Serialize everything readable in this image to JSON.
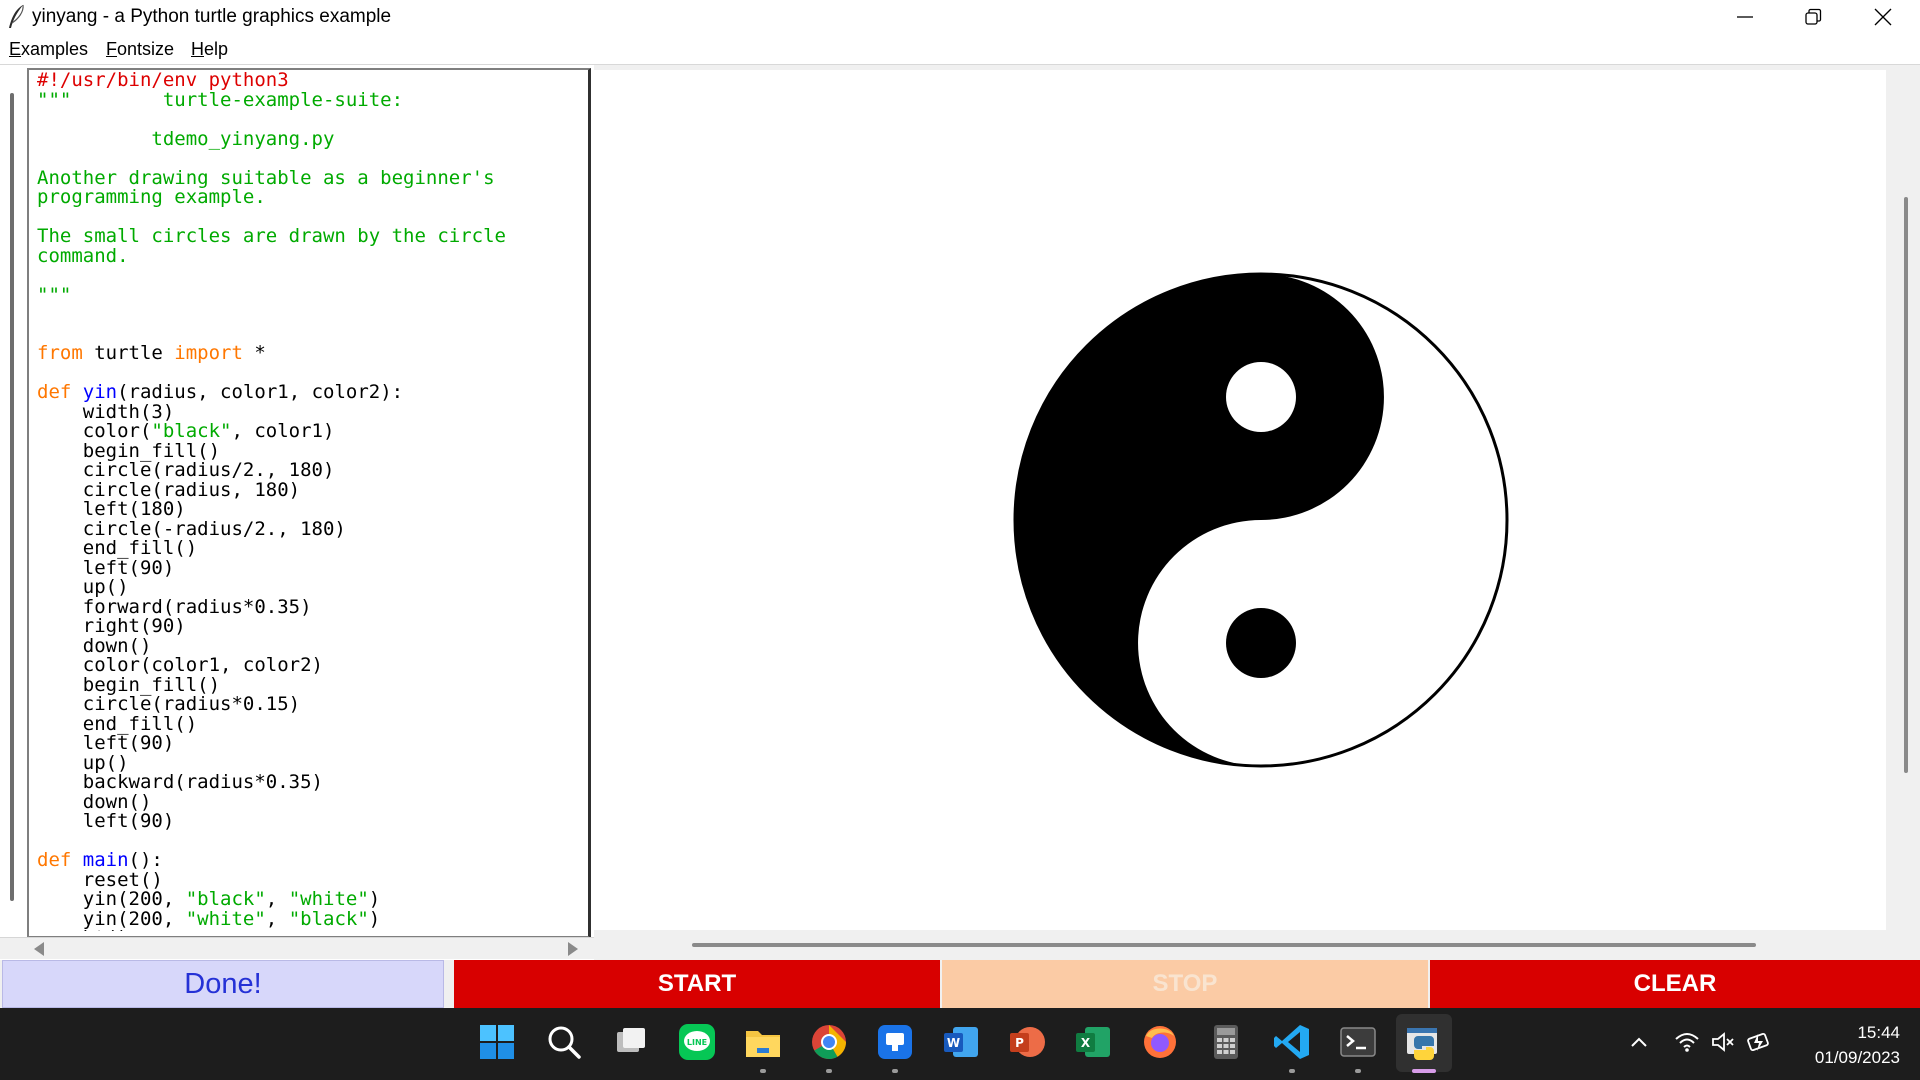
{
  "window": {
    "title": "yinyang - a Python turtle graphics example",
    "controls": [
      "minimize",
      "restore",
      "close"
    ]
  },
  "menu": {
    "items": [
      {
        "label": "Examples",
        "accel": "E",
        "rest": "xamples"
      },
      {
        "label": "Fontsize",
        "accel": "F",
        "rest": "ontsize"
      },
      {
        "label": "Help",
        "accel": "H",
        "rest": "elp"
      }
    ]
  },
  "colors": {
    "code_default": "#000000",
    "code_keyword": "#ff7700",
    "code_string": "#00aa00",
    "code_definition": "#0000ff",
    "code_comment": "#dd0000",
    "button_start": "#d80000",
    "button_stop": "#fbcba5",
    "button_clear": "#d80000",
    "button_done_bg": "#d7d7fa",
    "button_done_text": "#2531d6"
  },
  "code": {
    "lines": [
      [
        {
          "t": "#!/usr/bin/env python3",
          "c": "comment"
        }
      ],
      [
        {
          "t": "\"\"\"        turtle-example-suite:",
          "c": "string"
        }
      ],
      [
        {
          "t": "",
          "c": "string"
        }
      ],
      [
        {
          "t": "          tdemo_yinyang.py",
          "c": "string"
        }
      ],
      [
        {
          "t": "",
          "c": "string"
        }
      ],
      [
        {
          "t": "Another drawing suitable as a beginner's",
          "c": "string"
        }
      ],
      [
        {
          "t": "programming example.",
          "c": "string"
        }
      ],
      [
        {
          "t": "",
          "c": "string"
        }
      ],
      [
        {
          "t": "The small circles are drawn by the circle",
          "c": "string"
        }
      ],
      [
        {
          "t": "command.",
          "c": "string"
        }
      ],
      [
        {
          "t": "",
          "c": "string"
        }
      ],
      [
        {
          "t": "\"\"\"",
          "c": "string"
        }
      ],
      [
        {
          "t": "",
          "c": "default"
        }
      ],
      [
        {
          "t": "",
          "c": "default"
        }
      ],
      [
        {
          "t": "from",
          "c": "keyword"
        },
        {
          "t": " turtle ",
          "c": "default"
        },
        {
          "t": "import",
          "c": "keyword"
        },
        {
          "t": " *",
          "c": "default"
        }
      ],
      [
        {
          "t": "",
          "c": "default"
        }
      ],
      [
        {
          "t": "def",
          "c": "keyword"
        },
        {
          "t": " ",
          "c": "default"
        },
        {
          "t": "yin",
          "c": "definition"
        },
        {
          "t": "(radius, color1, color2):",
          "c": "default"
        }
      ],
      [
        {
          "t": "    width(3)",
          "c": "default"
        }
      ],
      [
        {
          "t": "    color(",
          "c": "default"
        },
        {
          "t": "\"black\"",
          "c": "string"
        },
        {
          "t": ", color1)",
          "c": "default"
        }
      ],
      [
        {
          "t": "    begin_fill()",
          "c": "default"
        }
      ],
      [
        {
          "t": "    circle(radius/2., 180)",
          "c": "default"
        }
      ],
      [
        {
          "t": "    circle(radius, 180)",
          "c": "default"
        }
      ],
      [
        {
          "t": "    left(180)",
          "c": "default"
        }
      ],
      [
        {
          "t": "    circle(-radius/2., 180)",
          "c": "default"
        }
      ],
      [
        {
          "t": "    end_fill()",
          "c": "default"
        }
      ],
      [
        {
          "t": "    left(90)",
          "c": "default"
        }
      ],
      [
        {
          "t": "    up()",
          "c": "default"
        }
      ],
      [
        {
          "t": "    forward(radius*0.35)",
          "c": "default"
        }
      ],
      [
        {
          "t": "    right(90)",
          "c": "default"
        }
      ],
      [
        {
          "t": "    down()",
          "c": "default"
        }
      ],
      [
        {
          "t": "    color(color1, color2)",
          "c": "default"
        }
      ],
      [
        {
          "t": "    begin_fill()",
          "c": "default"
        }
      ],
      [
        {
          "t": "    circle(radius*0.15)",
          "c": "default"
        }
      ],
      [
        {
          "t": "    end_fill()",
          "c": "default"
        }
      ],
      [
        {
          "t": "    left(90)",
          "c": "default"
        }
      ],
      [
        {
          "t": "    up()",
          "c": "default"
        }
      ],
      [
        {
          "t": "    backward(radius*0.35)",
          "c": "default"
        }
      ],
      [
        {
          "t": "    down()",
          "c": "default"
        }
      ],
      [
        {
          "t": "    left(90)",
          "c": "default"
        }
      ],
      [
        {
          "t": "",
          "c": "default"
        }
      ],
      [
        {
          "t": "def",
          "c": "keyword"
        },
        {
          "t": " ",
          "c": "default"
        },
        {
          "t": "main",
          "c": "definition"
        },
        {
          "t": "():",
          "c": "default"
        }
      ],
      [
        {
          "t": "    reset()",
          "c": "default"
        }
      ],
      [
        {
          "t": "    yin(200, ",
          "c": "default"
        },
        {
          "t": "\"black\"",
          "c": "string"
        },
        {
          "t": ", ",
          "c": "default"
        },
        {
          "t": "\"white\"",
          "c": "string"
        },
        {
          "t": ")",
          "c": "default"
        }
      ],
      [
        {
          "t": "    yin(200, ",
          "c": "default"
        },
        {
          "t": "\"white\"",
          "c": "string"
        },
        {
          "t": ", ",
          "c": "default"
        },
        {
          "t": "\"black\"",
          "c": "string"
        },
        {
          "t": ")",
          "c": "default"
        }
      ],
      [
        {
          "t": "    ht()",
          "c": "default"
        }
      ]
    ]
  },
  "buttons": {
    "done": "Done!",
    "start": "START",
    "stop": "STOP",
    "clear": "CLEAR"
  },
  "taskbar": {
    "apps": [
      "windows-start-icon",
      "search-icon",
      "task-view-icon",
      "line-app-icon",
      "file-explorer-icon",
      "chrome-icon",
      "word-pad-icon",
      "word-icon",
      "powerpoint-icon",
      "excel-icon",
      "firefox-icon",
      "calculator-icon",
      "vscode-icon",
      "terminal-icon",
      "python-idle-icon"
    ],
    "time": "15:44",
    "date": "01/09/2023"
  }
}
